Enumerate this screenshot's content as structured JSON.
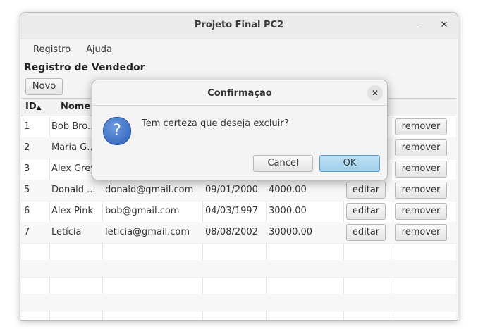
{
  "window": {
    "title": "Projeto Final PC2",
    "minimize_glyph": "–",
    "close_glyph": "✕"
  },
  "menu": [
    "Registro",
    "Ajuda"
  ],
  "page": {
    "heading": "Registro de Vendedor",
    "new_button": "Novo"
  },
  "table": {
    "columns": [
      "ID",
      "Nome"
    ],
    "sort_indicator": "▲",
    "rows": [
      {
        "id": "1",
        "nome": "Bob Bro..",
        "email": "",
        "data": "",
        "salario": "",
        "edit": "",
        "remove": "remover"
      },
      {
        "id": "2",
        "nome": "Maria G..",
        "email": "",
        "data": "",
        "salario": "",
        "edit": "",
        "remove": "remover"
      },
      {
        "id": "3",
        "nome": "Alex Grey",
        "email": "",
        "data": "",
        "salario": "",
        "edit": "",
        "remove": "remover"
      },
      {
        "id": "5",
        "nome": "Donald ...",
        "email": "donald@gmail.com",
        "data": "09/01/2000",
        "salario": "4000.00",
        "edit": "editar",
        "remove": "remover"
      },
      {
        "id": "6",
        "nome": "Alex Pink",
        "email": "bob@gmail.com",
        "data": "04/03/1997",
        "salario": "3000.00",
        "edit": "editar",
        "remove": "remover"
      },
      {
        "id": "7",
        "nome": "Letícia",
        "email": "leticia@gmail.com",
        "data": "08/08/2002",
        "salario": "30000.00",
        "edit": "editar",
        "remove": "remover"
      }
    ]
  },
  "dialog": {
    "title": "Confirmação",
    "close_glyph": "✕",
    "icon": "question-icon",
    "icon_glyph": "?",
    "message": "Tem certeza que deseja excluir?",
    "cancel_label": "Cancel",
    "ok_label": "OK"
  },
  "colors": {
    "ok_button": "#a8d5ef",
    "question_icon": "#3a6fc4"
  }
}
